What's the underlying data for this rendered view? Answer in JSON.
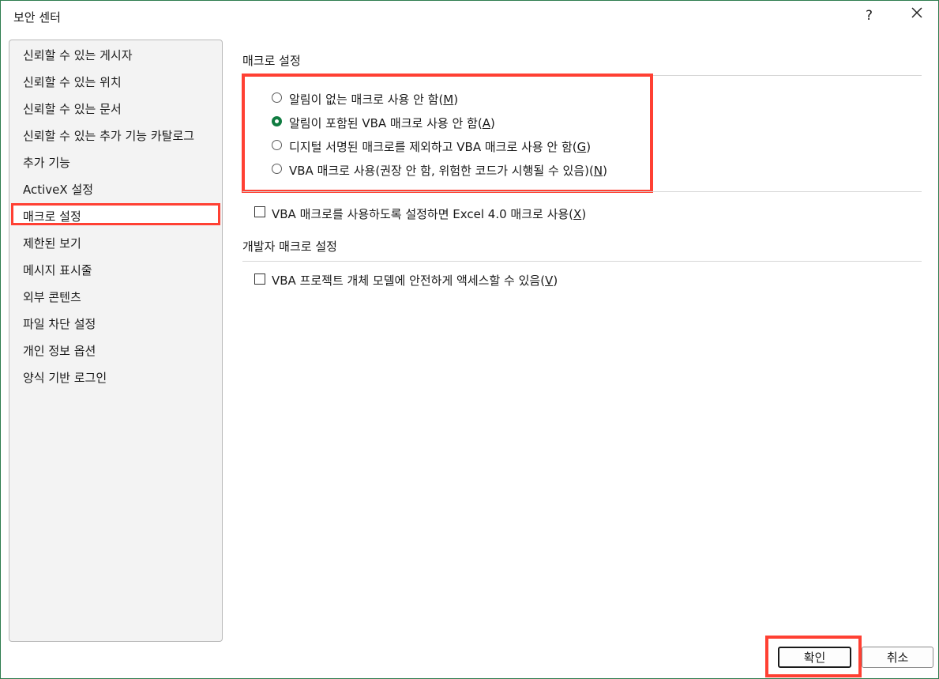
{
  "window": {
    "title": "보안 센터",
    "help_label": "?",
    "close_icon": "close-icon"
  },
  "sidebar": {
    "items": [
      {
        "label": "신뢰할 수 있는 게시자"
      },
      {
        "label": "신뢰할 수 있는 위치"
      },
      {
        "label": "신뢰할 수 있는 문서"
      },
      {
        "label": "신뢰할 수 있는 추가 기능 카탈로그"
      },
      {
        "label": "추가 기능"
      },
      {
        "label": "ActiveX 설정"
      },
      {
        "label": "매크로 설정",
        "selected": true
      },
      {
        "label": "제한된 보기"
      },
      {
        "label": "메시지 표시줄"
      },
      {
        "label": "외부 콘텐츠"
      },
      {
        "label": "파일 차단 설정"
      },
      {
        "label": "개인 정보 옵션"
      },
      {
        "label": "양식 기반 로그인"
      }
    ]
  },
  "macro": {
    "title": "매크로 설정",
    "options": [
      {
        "text": "알림이 없는 매크로 사용 안 함(",
        "key": "M",
        "close": ")",
        "checked": false
      },
      {
        "text": "알림이 포함된 VBA 매크로 사용 안 함(",
        "key": "A",
        "close": ")",
        "checked": true
      },
      {
        "text": "디지털 서명된 매크로를 제외하고 VBA 매크로 사용 안 함(",
        "key": "G",
        "close": ")",
        "checked": false
      },
      {
        "text": "VBA 매크로 사용(권장 안 함, 위험한 코드가 시행될 수 있음)(",
        "key": "N",
        "close": ")",
        "checked": false
      }
    ],
    "excel4": {
      "text": "VBA 매크로를 사용하도록 설정하면 Excel 4.0 매크로 사용(",
      "key": "X",
      "close": ")",
      "checked": false
    }
  },
  "developer": {
    "title": "개발자 매크로 설정",
    "vba_access": {
      "text": "VBA 프로젝트 개체 모델에 안전하게 액세스할 수 있음(",
      "key": "V",
      "close": ")",
      "checked": false
    }
  },
  "buttons": {
    "ok": "확인",
    "cancel": "취소"
  },
  "colors": {
    "accent": "#107c41",
    "highlight": "#ff4033"
  }
}
